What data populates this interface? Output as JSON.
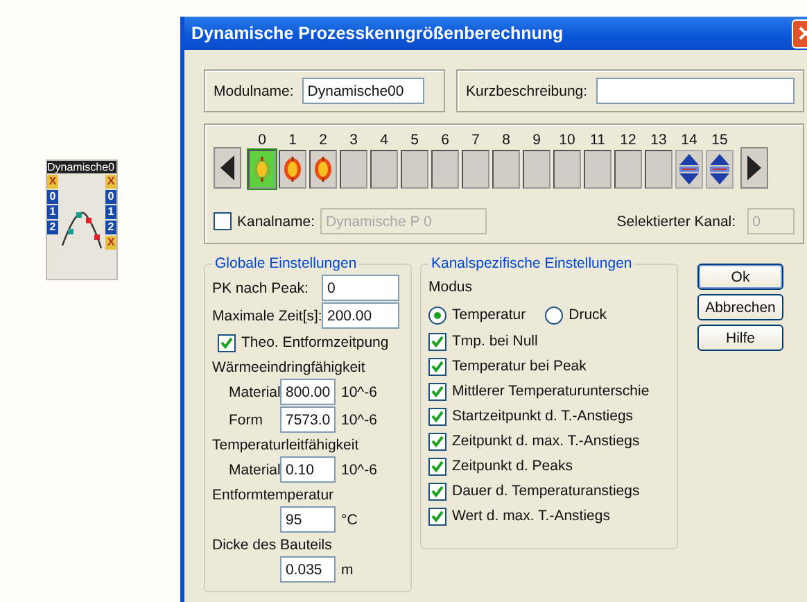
{
  "canvas": {
    "module": {
      "title": "Dynamische0",
      "inputs": [
        "X",
        "0",
        "1",
        "2"
      ],
      "outputs": [
        "X",
        "0",
        "1",
        "2",
        "X"
      ]
    }
  },
  "window": {
    "title": "Dynamische Prozesskenngrößenberechnung"
  },
  "module_name": {
    "label": "Modulname:",
    "value": "Dynamische00"
  },
  "short_description": {
    "label": "Kurzbeschreibung:"
  },
  "channels": [
    {
      "number": "0",
      "kind": "green",
      "selected": true
    },
    {
      "number": "1",
      "kind": "orange",
      "selected": false
    },
    {
      "number": "2",
      "kind": "orange",
      "selected": false
    },
    {
      "number": "3",
      "kind": "empty",
      "selected": false
    },
    {
      "number": "4",
      "kind": "empty",
      "selected": false
    },
    {
      "number": "5",
      "kind": "empty",
      "selected": false
    },
    {
      "number": "6",
      "kind": "empty",
      "selected": false
    },
    {
      "number": "7",
      "kind": "empty",
      "selected": false
    },
    {
      "number": "8",
      "kind": "empty",
      "selected": false
    },
    {
      "number": "9",
      "kind": "empty",
      "selected": false
    },
    {
      "number": "10",
      "kind": "empty",
      "selected": false
    },
    {
      "number": "11",
      "kind": "empty",
      "selected": false
    },
    {
      "number": "12",
      "kind": "empty",
      "selected": false
    },
    {
      "number": "13",
      "kind": "empty",
      "selected": false
    },
    {
      "number": "14",
      "kind": "blue",
      "selected": false
    },
    {
      "number": "15",
      "kind": "blue",
      "selected": false
    }
  ],
  "channel_name": {
    "label": "Kanalname:",
    "checked": false,
    "value": "Dynamische P 0",
    "disabled": true
  },
  "selected_channel": {
    "label": "Selektierter Kanal:",
    "value": "0"
  },
  "global_settings": {
    "title": "Globale Einstellungen",
    "items": [
      {
        "kind": "field",
        "label": "PK nach Peak:",
        "value": "0"
      },
      {
        "kind": "field",
        "label": "Maximale Zeit[s]:",
        "value": "200.00"
      },
      {
        "kind": "check",
        "label": "Theo. Entformzeitpung",
        "checked": true
      },
      {
        "kind": "heading",
        "label": "Wärmeeindringfähigkeit"
      },
      {
        "kind": "sub-field",
        "label": "Material",
        "value": "800.00",
        "unit": "10^-6"
      },
      {
        "kind": "sub-field",
        "label": "Form",
        "value": "7573.0",
        "unit": "10^-6"
      },
      {
        "kind": "heading",
        "label": "Temperaturleitfähigkeit"
      },
      {
        "kind": "sub-field",
        "label": "Material",
        "value": "0.10",
        "unit": "10^-6"
      },
      {
        "kind": "heading",
        "label": "Entformtemperatur"
      },
      {
        "kind": "unit-field",
        "value": "95",
        "unit": "°C"
      },
      {
        "kind": "heading",
        "label": "Dicke des Bauteils"
      },
      {
        "kind": "unit-field",
        "value": "0.035",
        "unit": "m"
      }
    ]
  },
  "channel_settings": {
    "title": "Kanalspezifische Einstellungen",
    "mode_label": "Modus",
    "modes": [
      {
        "label": "Temperatur",
        "selected": true
      },
      {
        "label": "Druck",
        "selected": false
      }
    ],
    "checks": [
      {
        "label": "Tmp. bei Null",
        "checked": true
      },
      {
        "label": "Temperatur bei Peak",
        "checked": true
      },
      {
        "label": "Mittlerer Temperaturunterschie",
        "checked": true
      },
      {
        "label": "Startzeitpunkt d. T.-Anstiegs",
        "checked": true
      },
      {
        "label": "Zeitpunkt d. max. T.-Anstiegs",
        "checked": true
      },
      {
        "label": "Zeitpunkt d. Peaks",
        "checked": true
      },
      {
        "label": "Dauer d. Temperaturanstiegs",
        "checked": true
      },
      {
        "label": "Wert d. max. T.-Anstiegs",
        "checked": true
      }
    ]
  },
  "buttons": [
    {
      "label": "Ok",
      "default": true
    },
    {
      "label": "Abbrechen",
      "default": false
    },
    {
      "label": "Hilfe",
      "default": false
    }
  ]
}
